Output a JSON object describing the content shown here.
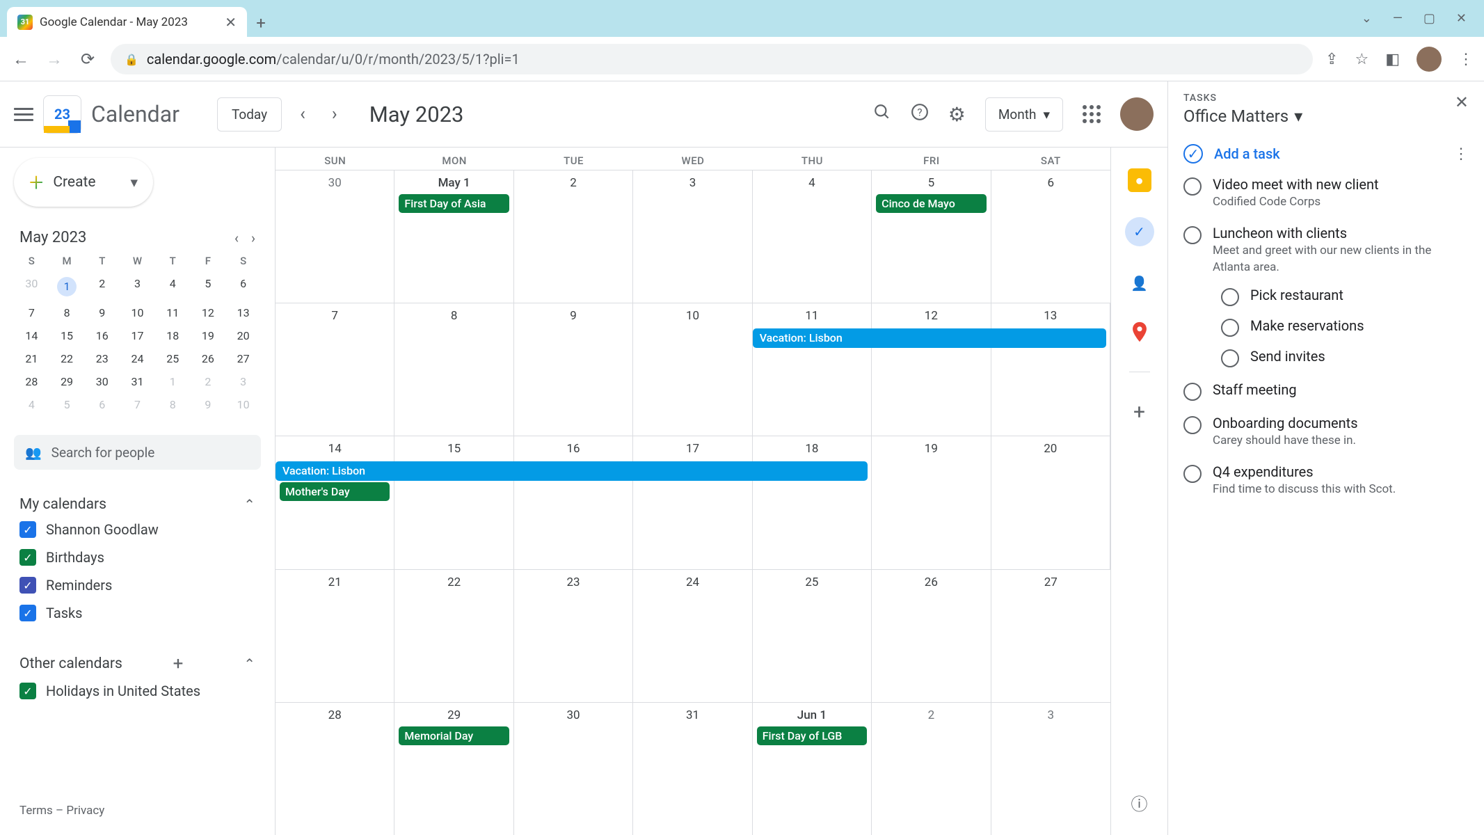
{
  "browser": {
    "tab_title": "Google Calendar - May 2023",
    "url_domain": "calendar.google.com",
    "url_path": "/calendar/u/0/r/month/2023/5/1?pli=1"
  },
  "header": {
    "logo_day": "23",
    "app_name": "Calendar",
    "today": "Today",
    "month_year": "May 2023",
    "view": "Month"
  },
  "sidebar": {
    "create": "Create",
    "mini_month": "May 2023",
    "dow": [
      "S",
      "M",
      "T",
      "W",
      "T",
      "F",
      "S"
    ],
    "mini_days": [
      {
        "n": "30",
        "dim": true
      },
      {
        "n": "1",
        "sel": true
      },
      {
        "n": "2"
      },
      {
        "n": "3"
      },
      {
        "n": "4"
      },
      {
        "n": "5"
      },
      {
        "n": "6"
      },
      {
        "n": "7"
      },
      {
        "n": "8"
      },
      {
        "n": "9"
      },
      {
        "n": "10"
      },
      {
        "n": "11"
      },
      {
        "n": "12"
      },
      {
        "n": "13"
      },
      {
        "n": "14"
      },
      {
        "n": "15"
      },
      {
        "n": "16"
      },
      {
        "n": "17"
      },
      {
        "n": "18"
      },
      {
        "n": "19"
      },
      {
        "n": "20"
      },
      {
        "n": "21"
      },
      {
        "n": "22"
      },
      {
        "n": "23"
      },
      {
        "n": "24"
      },
      {
        "n": "25"
      },
      {
        "n": "26"
      },
      {
        "n": "27"
      },
      {
        "n": "28"
      },
      {
        "n": "29"
      },
      {
        "n": "30"
      },
      {
        "n": "31"
      },
      {
        "n": "1",
        "dim": true
      },
      {
        "n": "2",
        "dim": true
      },
      {
        "n": "3",
        "dim": true
      },
      {
        "n": "4",
        "dim": true
      },
      {
        "n": "5",
        "dim": true
      },
      {
        "n": "6",
        "dim": true
      },
      {
        "n": "7",
        "dim": true
      },
      {
        "n": "8",
        "dim": true
      },
      {
        "n": "9",
        "dim": true
      },
      {
        "n": "10",
        "dim": true
      }
    ],
    "search_placeholder": "Search for people",
    "my_cal_label": "My calendars",
    "my_cals": [
      {
        "label": "Shannon Goodlaw",
        "color": "#1a73e8"
      },
      {
        "label": "Birthdays",
        "color": "#0b8043"
      },
      {
        "label": "Reminders",
        "color": "#3f51b5"
      },
      {
        "label": "Tasks",
        "color": "#1a73e8"
      }
    ],
    "other_cal_label": "Other calendars",
    "other_cals": [
      {
        "label": "Holidays in United States",
        "color": "#0b8043"
      }
    ],
    "terms": "Terms",
    "privacy": "Privacy"
  },
  "grid": {
    "dow": [
      "SUN",
      "MON",
      "TUE",
      "WED",
      "THU",
      "FRI",
      "SAT"
    ],
    "weeks": [
      {
        "days": [
          {
            "n": "30",
            "dim": true
          },
          {
            "n": "May 1",
            "bold": true,
            "events": [
              {
                "t": "First Day of Asia",
                "c": "green"
              }
            ]
          },
          {
            "n": "2"
          },
          {
            "n": "3"
          },
          {
            "n": "4"
          },
          {
            "n": "5",
            "events": [
              {
                "t": "Cinco de Mayo",
                "c": "green"
              }
            ]
          },
          {
            "n": "6"
          }
        ]
      },
      {
        "days": [
          {
            "n": "7"
          },
          {
            "n": "8"
          },
          {
            "n": "9"
          },
          {
            "n": "10"
          },
          {
            "n": "11"
          },
          {
            "n": "12"
          },
          {
            "n": "13"
          }
        ],
        "span": {
          "start": 5,
          "end": 7,
          "label": "Vacation: Lisbon"
        }
      },
      {
        "days": [
          {
            "n": "14",
            "events": [
              {
                "t": "Mother's Day",
                "c": "green",
                "offset": true
              }
            ]
          },
          {
            "n": "15"
          },
          {
            "n": "16"
          },
          {
            "n": "17"
          },
          {
            "n": "18"
          },
          {
            "n": "19"
          },
          {
            "n": "20"
          }
        ],
        "span": {
          "start": 1,
          "end": 5,
          "label": "Vacation: Lisbon"
        }
      },
      {
        "days": [
          {
            "n": "21"
          },
          {
            "n": "22"
          },
          {
            "n": "23"
          },
          {
            "n": "24"
          },
          {
            "n": "25"
          },
          {
            "n": "26"
          },
          {
            "n": "27"
          }
        ]
      },
      {
        "days": [
          {
            "n": "28"
          },
          {
            "n": "29",
            "events": [
              {
                "t": "Memorial Day",
                "c": "green"
              }
            ]
          },
          {
            "n": "30"
          },
          {
            "n": "31"
          },
          {
            "n": "Jun 1",
            "bold": true,
            "events": [
              {
                "t": "First Day of LGB",
                "c": "green"
              }
            ]
          },
          {
            "n": "2",
            "dim": true
          },
          {
            "n": "3",
            "dim": true
          }
        ]
      }
    ]
  },
  "tasks": {
    "heading": "TASKS",
    "list_name": "Office Matters",
    "add": "Add a task",
    "items": [
      {
        "title": "Video meet with new client",
        "desc": "Codified Code Corps"
      },
      {
        "title": "Luncheon with clients",
        "desc": "Meet and greet with our new clients in the Atlanta area.",
        "sub": [
          {
            "title": "Pick restaurant"
          },
          {
            "title": "Make reservations"
          },
          {
            "title": "Send invites"
          }
        ]
      },
      {
        "title": "Staff meeting"
      },
      {
        "title": "Onboarding documents",
        "desc": "Carey should have these in."
      },
      {
        "title": "Q4 expenditures",
        "desc": "Find time to discuss this with Scot."
      }
    ]
  }
}
